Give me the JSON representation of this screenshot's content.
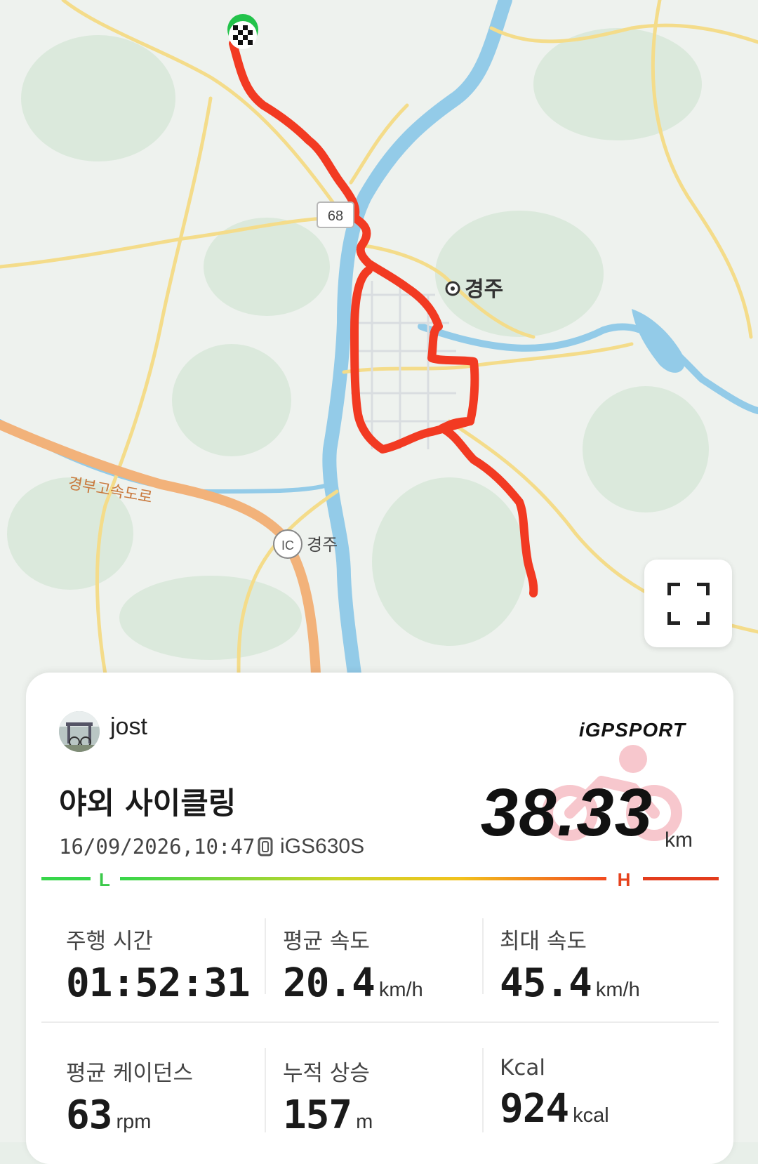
{
  "map": {
    "labels": {
      "city": "경주",
      "route_number": "68",
      "expressway": "경부고속도로",
      "ic_badge": "IC",
      "ic_name": "경주"
    },
    "colors": {
      "route": "#f23a22",
      "river": "#8fc9e8",
      "road": "#f4dc8a",
      "highway": "#f2b27a"
    }
  },
  "controls": {
    "fullscreen_icon": "fullscreen-icon"
  },
  "activity": {
    "user_name": "jost",
    "brand": "iGPSPORT",
    "title": "야외 사이클링",
    "datetime": "16/09/2026,10:47",
    "device": "iGS630S",
    "distance": "38.33",
    "distance_unit": "km",
    "scale_low": "L",
    "scale_high": "H"
  },
  "stats": [
    {
      "label": "주행 시간",
      "value": "01:52:31",
      "unit": ""
    },
    {
      "label": "평균 속도",
      "value": "20.4",
      "unit": "km/h"
    },
    {
      "label": "최대 속도",
      "value": "45.4",
      "unit": "km/h"
    },
    {
      "label": "평균 케이던스",
      "value": "63",
      "unit": "rpm"
    },
    {
      "label": "누적 상승",
      "value": "157",
      "unit": "m"
    },
    {
      "label": "Kcal",
      "value": "924",
      "unit": "kcal"
    }
  ]
}
